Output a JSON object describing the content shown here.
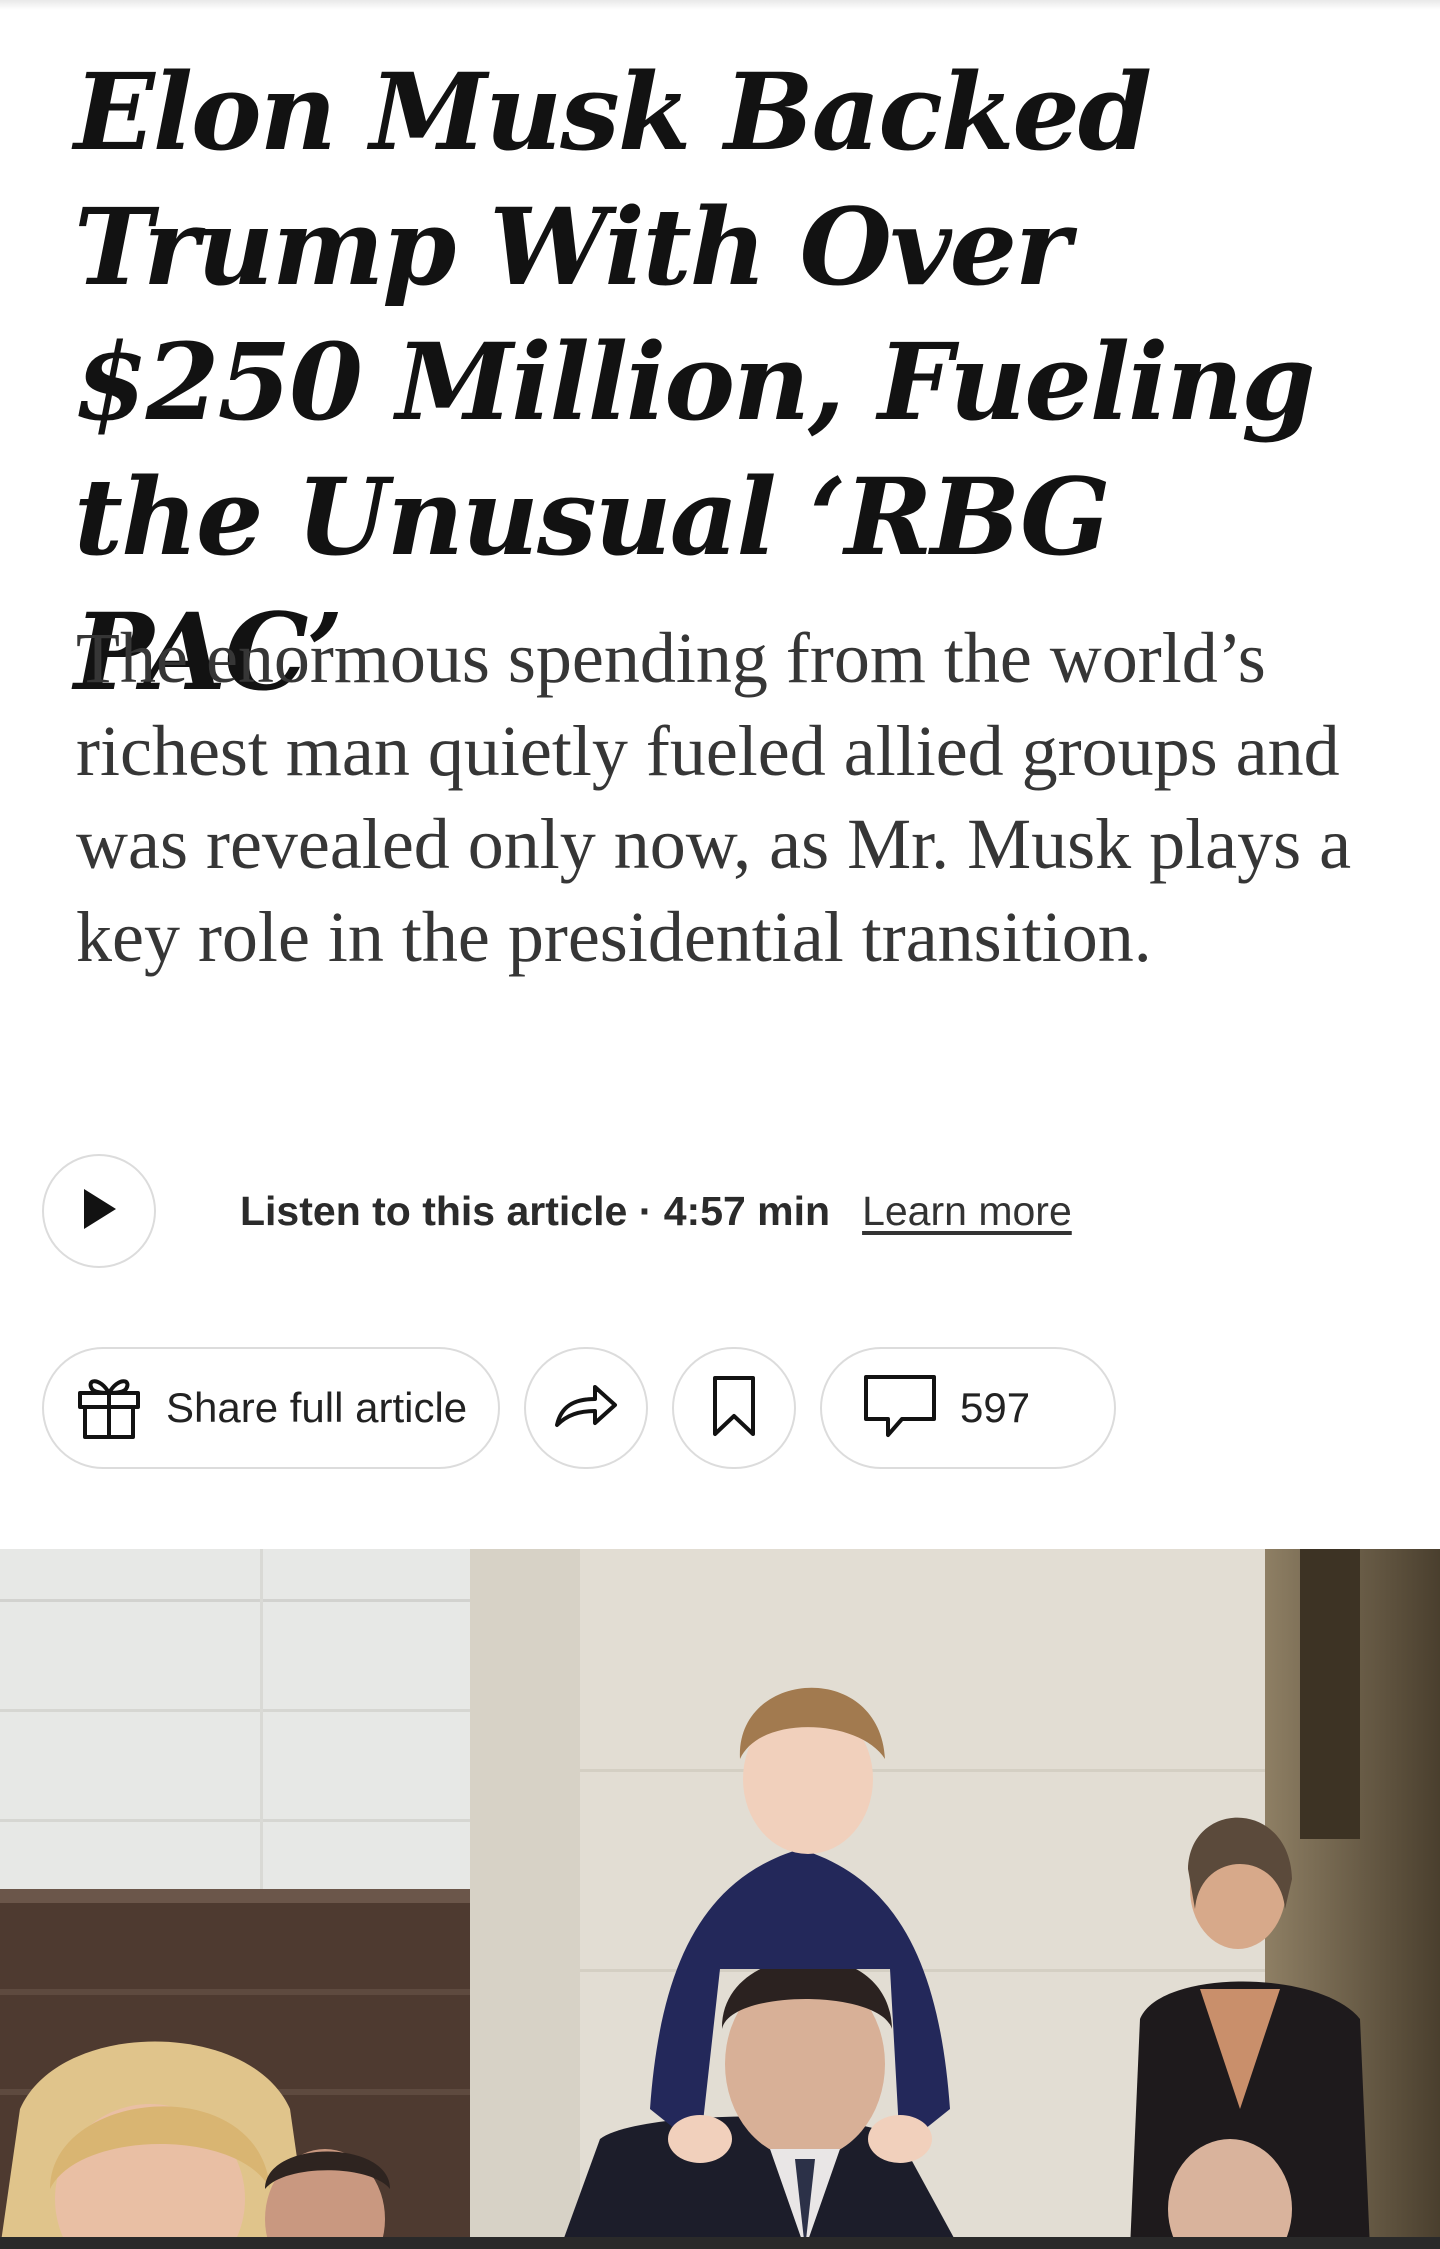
{
  "article": {
    "headline": "Elon Musk Backed Trump With Over $250 Million, Fueling the Unusual ‘RBG PAC’",
    "summary": "The enormous spending from the world’s richest man quietly fueled allied groups and was revealed only now, as Mr. Musk plays a key role in the presidential transition."
  },
  "audio": {
    "label": "Listen to this article · 4:57 min",
    "learn_more": "Learn more",
    "icon": "play-icon"
  },
  "actions": {
    "share_full_label": "Share full article",
    "share_full_icon": "gift-icon",
    "share_icon": "share-arrow-icon",
    "save_icon": "bookmark-icon",
    "comments_icon": "comment-bubble-icon",
    "comments_count": "597"
  }
}
